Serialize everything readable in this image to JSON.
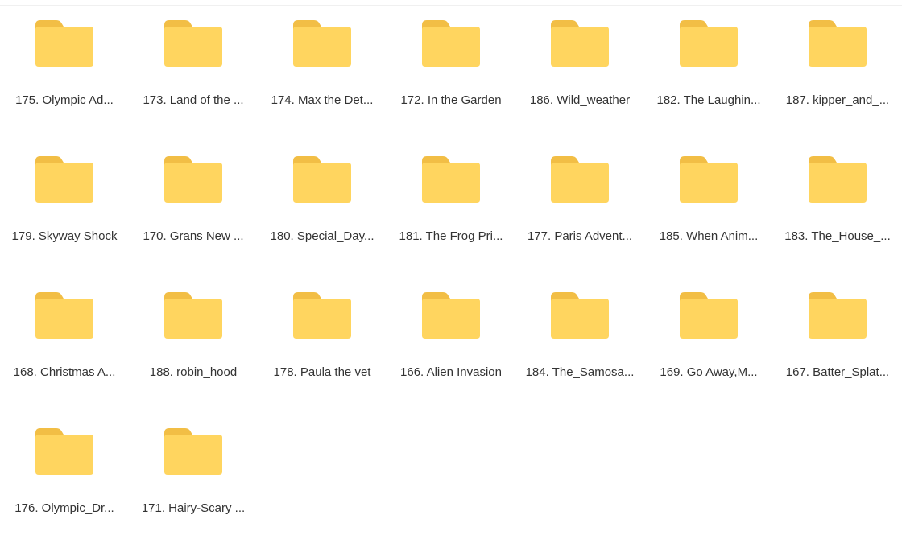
{
  "colors": {
    "folder_body": "#FFD55F",
    "folder_tab": "#F2BE45",
    "label_text": "#333333"
  },
  "icon": "folder-icon",
  "folders": [
    {
      "label": "175. Olympic Ad..."
    },
    {
      "label": "173. Land of the ..."
    },
    {
      "label": "174. Max the Det..."
    },
    {
      "label": "172. In the Garden"
    },
    {
      "label": "186. Wild_weather"
    },
    {
      "label": "182. The Laughin..."
    },
    {
      "label": "187. kipper_and_..."
    },
    {
      "label": "179. Skyway Shock"
    },
    {
      "label": "170. Grans New ..."
    },
    {
      "label": "180. Special_Day..."
    },
    {
      "label": "181. The Frog Pri..."
    },
    {
      "label": "177. Paris Advent..."
    },
    {
      "label": "185. When Anim..."
    },
    {
      "label": "183. The_House_..."
    },
    {
      "label": "168. Christmas A..."
    },
    {
      "label": "188. robin_hood"
    },
    {
      "label": "178. Paula the vet"
    },
    {
      "label": "166. Alien Invasion"
    },
    {
      "label": "184. The_Samosa..."
    },
    {
      "label": "169. Go Away,M..."
    },
    {
      "label": "167. Batter_Splat..."
    },
    {
      "label": "176. Olympic_Dr..."
    },
    {
      "label": "171. Hairy-Scary ..."
    }
  ]
}
